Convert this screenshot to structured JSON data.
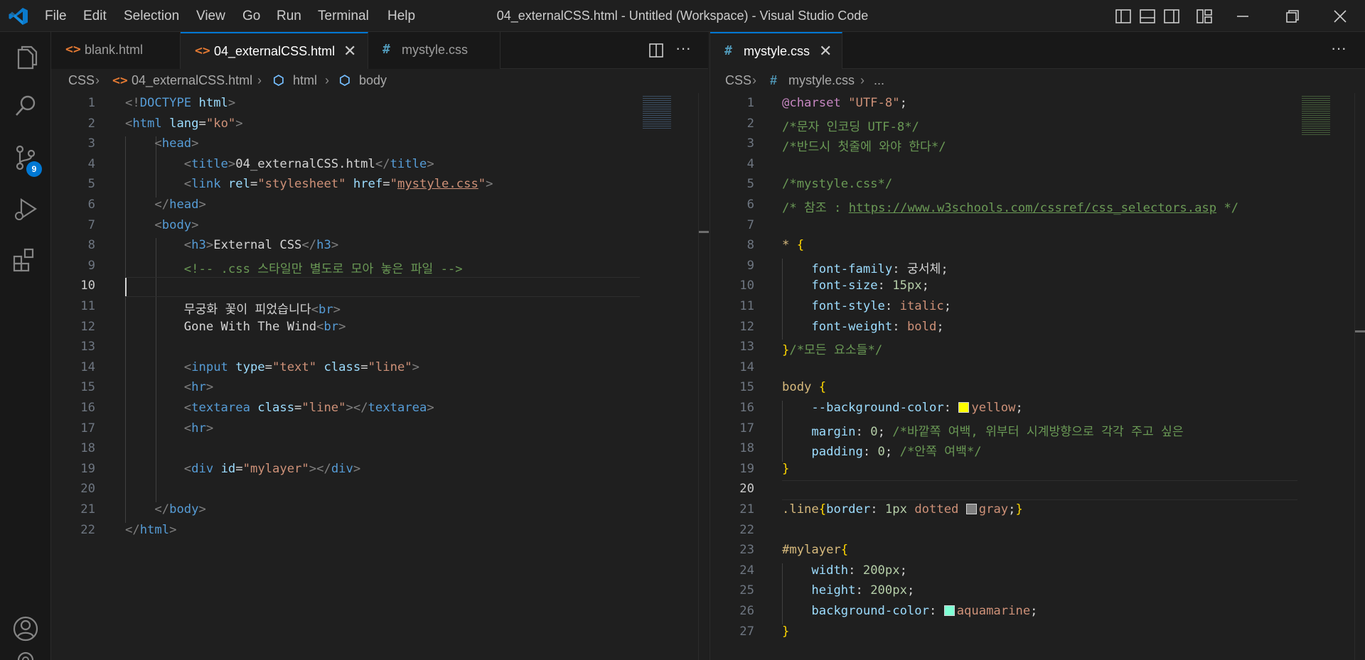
{
  "window": {
    "title": "04_externalCSS.html - Untitled (Workspace) - Visual Studio Code",
    "menu": [
      "File",
      "Edit",
      "Selection",
      "View",
      "Go",
      "Run",
      "Terminal",
      "Help"
    ]
  },
  "activity_bar": {
    "icons": [
      "files-icon",
      "search-icon",
      "source-control-icon",
      "run-debug-icon",
      "extensions-icon",
      "account-icon",
      "settings-gear-icon"
    ],
    "scm_badge": "9"
  },
  "left_group": {
    "tabs": [
      {
        "label": "blank.html",
        "icon": "<>",
        "type": "html",
        "active": false
      },
      {
        "label": "04_externalCSS.html",
        "icon": "<>",
        "type": "html",
        "active": true
      },
      {
        "label": "mystyle.css",
        "icon": "#",
        "type": "css",
        "active": false
      }
    ],
    "breadcrumb": [
      "CSS",
      "04_externalCSS.html",
      "html",
      "body"
    ]
  },
  "right_group": {
    "tabs": [
      {
        "label": "mystyle.css",
        "icon": "#",
        "type": "css",
        "active": true
      }
    ],
    "breadcrumb": [
      "CSS",
      "mystyle.css",
      "..."
    ]
  },
  "colors": {
    "accent": "#0078d4",
    "swatch_yellow": "#ffff00",
    "swatch_gray": "#808080",
    "swatch_aquamarine": "#7fffd4"
  },
  "html_code": [
    [
      [
        "t-br",
        "<!"
      ],
      [
        "t-tag",
        "DOCTYPE "
      ],
      [
        "t-attr",
        "html"
      ],
      [
        "t-br",
        ">"
      ]
    ],
    [
      [
        "t-br",
        "<"
      ],
      [
        "t-tag",
        "html "
      ],
      [
        "t-attr",
        "lang"
      ],
      [
        "t-txt",
        "="
      ],
      [
        "t-str",
        "\"ko\""
      ],
      [
        "t-br",
        ">"
      ]
    ],
    [
      [
        "t-txt",
        "    "
      ],
      [
        "t-br",
        "<"
      ],
      [
        "t-tag",
        "head"
      ],
      [
        "t-br",
        ">"
      ]
    ],
    [
      [
        "t-txt",
        "        "
      ],
      [
        "t-br",
        "<"
      ],
      [
        "t-tag",
        "title"
      ],
      [
        "t-br",
        ">"
      ],
      [
        "t-txt",
        "04_externalCSS.html"
      ],
      [
        "t-br",
        "</"
      ],
      [
        "t-tag",
        "title"
      ],
      [
        "t-br",
        ">"
      ]
    ],
    [
      [
        "t-txt",
        "        "
      ],
      [
        "t-br",
        "<"
      ],
      [
        "t-tag",
        "link "
      ],
      [
        "t-attr",
        "rel"
      ],
      [
        "t-txt",
        "="
      ],
      [
        "t-str",
        "\"stylesheet\" "
      ],
      [
        "t-attr",
        "href"
      ],
      [
        "t-txt",
        "="
      ],
      [
        "t-str",
        "\""
      ],
      [
        "t-str t-u",
        "mystyle.css"
      ],
      [
        "t-str",
        "\""
      ],
      [
        "t-br",
        ">"
      ]
    ],
    [
      [
        "t-txt",
        "    "
      ],
      [
        "t-br",
        "</"
      ],
      [
        "t-tag",
        "head"
      ],
      [
        "t-br",
        ">"
      ]
    ],
    [
      [
        "t-txt",
        "    "
      ],
      [
        "t-br",
        "<"
      ],
      [
        "t-tag",
        "body"
      ],
      [
        "t-br",
        ">"
      ]
    ],
    [
      [
        "t-txt",
        "        "
      ],
      [
        "t-br",
        "<"
      ],
      [
        "t-tag",
        "h3"
      ],
      [
        "t-br",
        ">"
      ],
      [
        "t-txt",
        "External CSS"
      ],
      [
        "t-br",
        "</"
      ],
      [
        "t-tag",
        "h3"
      ],
      [
        "t-br",
        ">"
      ]
    ],
    [
      [
        "t-txt",
        "        "
      ],
      [
        "t-com",
        "<!-- .css 스타일만 별도로 모아 놓은 파일 -->"
      ]
    ],
    [
      [
        "t-txt",
        ""
      ]
    ],
    [
      [
        "t-txt",
        "        무궁화 꽃이 피었습니다"
      ],
      [
        "t-br",
        "<"
      ],
      [
        "t-tag",
        "br"
      ],
      [
        "t-br",
        ">"
      ]
    ],
    [
      [
        "t-txt",
        "        Gone With The Wind"
      ],
      [
        "t-br",
        "<"
      ],
      [
        "t-tag",
        "br"
      ],
      [
        "t-br",
        ">"
      ]
    ],
    [
      [
        "t-txt",
        ""
      ]
    ],
    [
      [
        "t-txt",
        "        "
      ],
      [
        "t-br",
        "<"
      ],
      [
        "t-tag",
        "input "
      ],
      [
        "t-attr",
        "type"
      ],
      [
        "t-txt",
        "="
      ],
      [
        "t-str",
        "\"text\" "
      ],
      [
        "t-attr",
        "class"
      ],
      [
        "t-txt",
        "="
      ],
      [
        "t-str",
        "\"line\""
      ],
      [
        "t-br",
        ">"
      ]
    ],
    [
      [
        "t-txt",
        "        "
      ],
      [
        "t-br",
        "<"
      ],
      [
        "t-tag",
        "hr"
      ],
      [
        "t-br",
        ">"
      ]
    ],
    [
      [
        "t-txt",
        "        "
      ],
      [
        "t-br",
        "<"
      ],
      [
        "t-tag",
        "textarea "
      ],
      [
        "t-attr",
        "class"
      ],
      [
        "t-txt",
        "="
      ],
      [
        "t-str",
        "\"line\""
      ],
      [
        "t-br",
        "></"
      ],
      [
        "t-tag",
        "textarea"
      ],
      [
        "t-br",
        ">"
      ]
    ],
    [
      [
        "t-txt",
        "        "
      ],
      [
        "t-br",
        "<"
      ],
      [
        "t-tag",
        "hr"
      ],
      [
        "t-br",
        ">"
      ]
    ],
    [
      [
        "t-txt",
        ""
      ]
    ],
    [
      [
        "t-txt",
        "        "
      ],
      [
        "t-br",
        "<"
      ],
      [
        "t-tag",
        "div "
      ],
      [
        "t-attr",
        "id"
      ],
      [
        "t-txt",
        "="
      ],
      [
        "t-str",
        "\"mylayer\""
      ],
      [
        "t-br",
        "></"
      ],
      [
        "t-tag",
        "div"
      ],
      [
        "t-br",
        ">"
      ]
    ],
    [
      [
        "t-txt",
        ""
      ]
    ],
    [
      [
        "t-txt",
        "    "
      ],
      [
        "t-br",
        "</"
      ],
      [
        "t-tag",
        "body"
      ],
      [
        "t-br",
        ">"
      ]
    ],
    [
      [
        "t-br",
        "</"
      ],
      [
        "t-tag",
        "html"
      ],
      [
        "t-br",
        ">"
      ]
    ]
  ],
  "css_code": [
    [
      [
        "t-kw",
        "@charset "
      ],
      [
        "t-str",
        "\"UTF-8\""
      ],
      [
        "t-txt",
        ";"
      ]
    ],
    [
      [
        "t-com",
        "/*문자 인코딩 UTF-8*/"
      ]
    ],
    [
      [
        "t-com",
        "/*반드시 첫줄에 와야 한다*/"
      ]
    ],
    [
      [
        "t-txt",
        ""
      ]
    ],
    [
      [
        "t-com",
        "/*mystyle.css*/"
      ]
    ],
    [
      [
        "t-com",
        "/* 참조 : "
      ],
      [
        "t-link",
        "https://www.w3schools.com/cssref/css_selectors.asp"
      ],
      [
        "t-com",
        " */"
      ]
    ],
    [
      [
        "t-txt",
        ""
      ]
    ],
    [
      [
        "t-sel",
        "* "
      ],
      [
        "t-brace",
        "{"
      ]
    ],
    [
      [
        "t-txt",
        "    "
      ],
      [
        "t-prop",
        "font-family"
      ],
      [
        "t-txt",
        ": 궁서체;"
      ]
    ],
    [
      [
        "t-txt",
        "    "
      ],
      [
        "t-prop",
        "font-size"
      ],
      [
        "t-txt",
        ": "
      ],
      [
        "t-num",
        "15px"
      ],
      [
        "t-txt",
        ";"
      ]
    ],
    [
      [
        "t-txt",
        "    "
      ],
      [
        "t-prop",
        "font-style"
      ],
      [
        "t-txt",
        ": "
      ],
      [
        "t-str",
        "italic"
      ],
      [
        "t-txt",
        ";"
      ]
    ],
    [
      [
        "t-txt",
        "    "
      ],
      [
        "t-prop",
        "font-weight"
      ],
      [
        "t-txt",
        ": "
      ],
      [
        "t-str",
        "bold"
      ],
      [
        "t-txt",
        ";"
      ]
    ],
    [
      [
        "t-brace",
        "}"
      ],
      [
        "t-com",
        "/*모든 요소들*/"
      ]
    ],
    [
      [
        "t-txt",
        ""
      ]
    ],
    [
      [
        "t-sel",
        "body "
      ],
      [
        "t-brace",
        "{"
      ]
    ],
    [
      [
        "t-txt",
        "    "
      ],
      [
        "t-prop",
        "--background-color"
      ],
      [
        "t-txt",
        ": "
      ],
      [
        "swatch",
        "swatch_yellow"
      ],
      [
        "t-str",
        "yellow"
      ],
      [
        "t-txt",
        ";"
      ]
    ],
    [
      [
        "t-txt",
        "    "
      ],
      [
        "t-prop",
        "margin"
      ],
      [
        "t-txt",
        ": "
      ],
      [
        "t-num",
        "0"
      ],
      [
        "t-txt",
        "; "
      ],
      [
        "t-com",
        "/*바깥쪽 여백, 위부터 시계방향으로 각각 주고 싶은"
      ]
    ],
    [
      [
        "t-txt",
        "    "
      ],
      [
        "t-prop",
        "padding"
      ],
      [
        "t-txt",
        ": "
      ],
      [
        "t-num",
        "0"
      ],
      [
        "t-txt",
        "; "
      ],
      [
        "t-com",
        "/*안쪽 여백*/"
      ]
    ],
    [
      [
        "t-brace",
        "}"
      ]
    ],
    [
      [
        "t-txt",
        ""
      ]
    ],
    [
      [
        "t-sel",
        ".line"
      ],
      [
        "t-brace",
        "{"
      ],
      [
        "t-prop",
        "border"
      ],
      [
        "t-txt",
        ": "
      ],
      [
        "t-num",
        "1px "
      ],
      [
        "t-str",
        "dotted "
      ],
      [
        "swatch",
        "swatch_gray"
      ],
      [
        "t-str",
        "gray"
      ],
      [
        "t-txt",
        ";"
      ],
      [
        "t-brace",
        "}"
      ]
    ],
    [
      [
        "t-txt",
        ""
      ]
    ],
    [
      [
        "t-sel",
        "#mylayer"
      ],
      [
        "t-brace",
        "{"
      ]
    ],
    [
      [
        "t-txt",
        "    "
      ],
      [
        "t-prop",
        "width"
      ],
      [
        "t-txt",
        ": "
      ],
      [
        "t-num",
        "200px"
      ],
      [
        "t-txt",
        ";"
      ]
    ],
    [
      [
        "t-txt",
        "    "
      ],
      [
        "t-prop",
        "height"
      ],
      [
        "t-txt",
        ": "
      ],
      [
        "t-num",
        "200px"
      ],
      [
        "t-txt",
        ";"
      ]
    ],
    [
      [
        "t-txt",
        "    "
      ],
      [
        "t-prop",
        "background-color"
      ],
      [
        "t-txt",
        ": "
      ],
      [
        "swatch",
        "swatch_aquamarine"
      ],
      [
        "t-str",
        "aquamarine"
      ],
      [
        "t-txt",
        ";"
      ]
    ],
    [
      [
        "t-brace",
        "}"
      ]
    ]
  ]
}
